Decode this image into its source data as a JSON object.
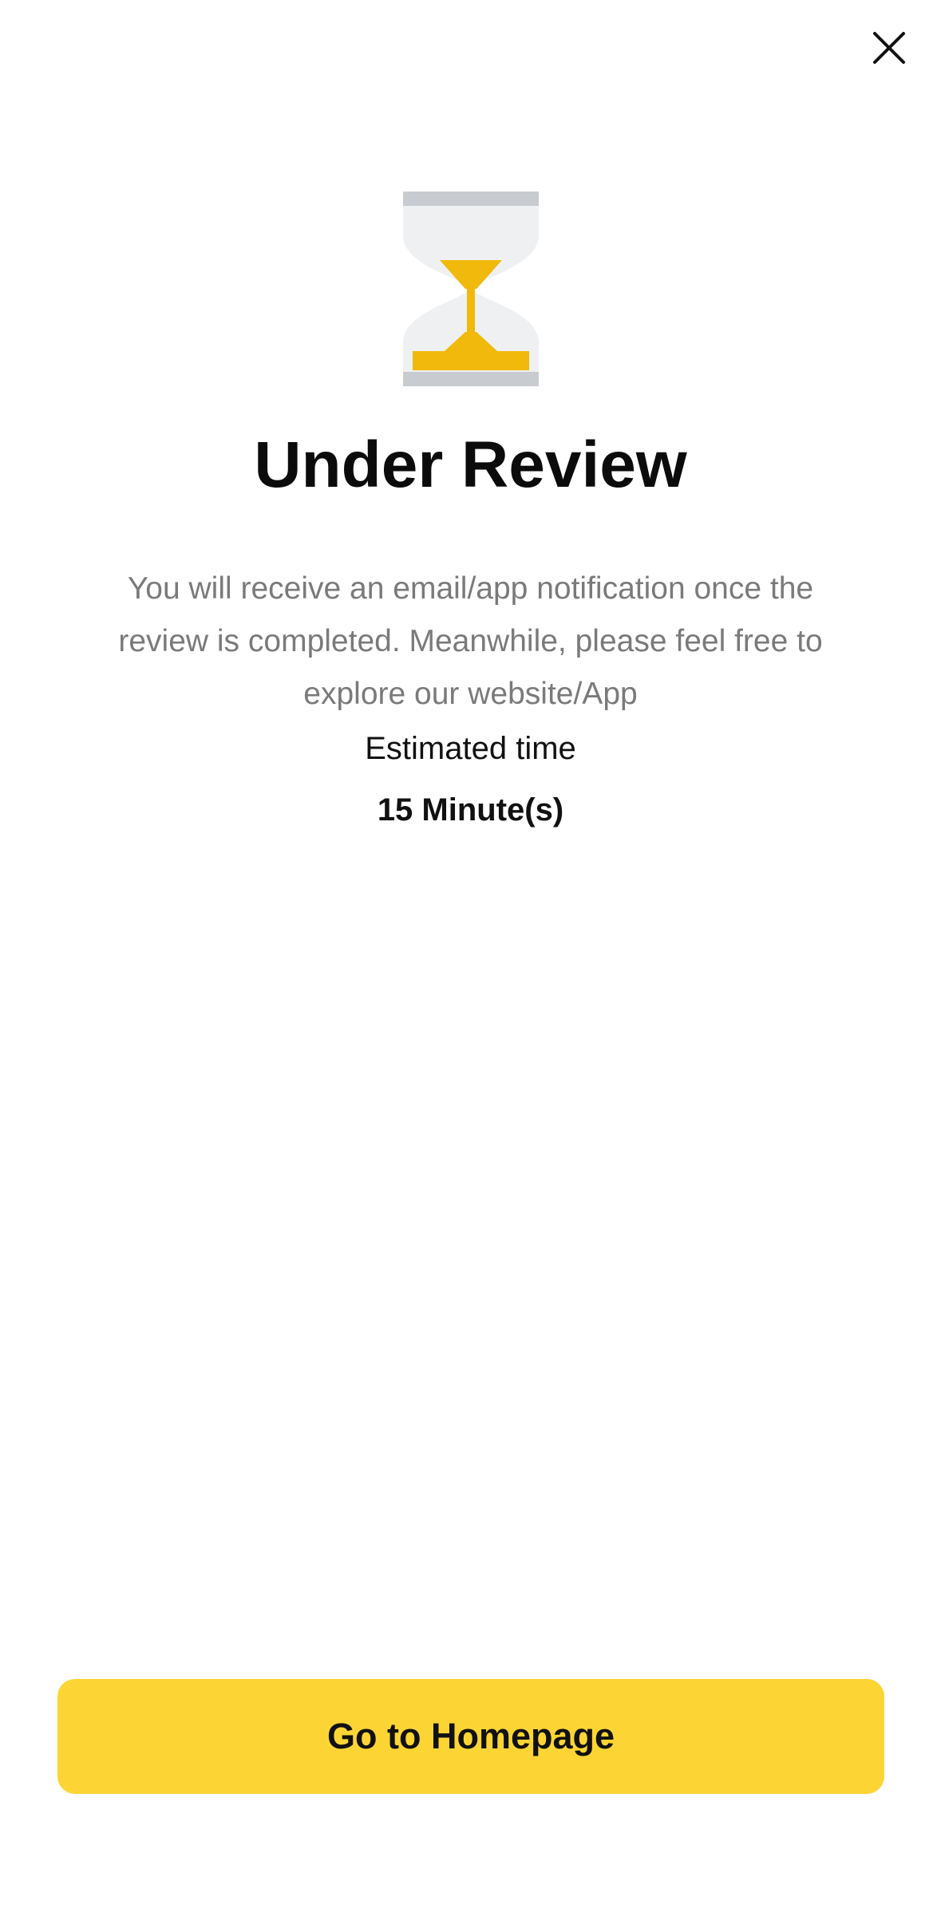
{
  "header": {
    "close_icon": "close-icon"
  },
  "status": {
    "icon": "hourglass-icon",
    "title": "Under Review",
    "description": "You will receive an email/app notification once the review is completed. Meanwhile, please feel free to explore our website/App",
    "estimated_label": "Estimated time",
    "estimated_value": "15 Minute(s)"
  },
  "actions": {
    "homepage_label": "Go to Homepage"
  },
  "colors": {
    "accent": "#FCD535",
    "sand": "#F0B90B",
    "glass": "#EFF0F1",
    "frame": "#C8CBD0",
    "muted_text": "#7A7A7A"
  }
}
